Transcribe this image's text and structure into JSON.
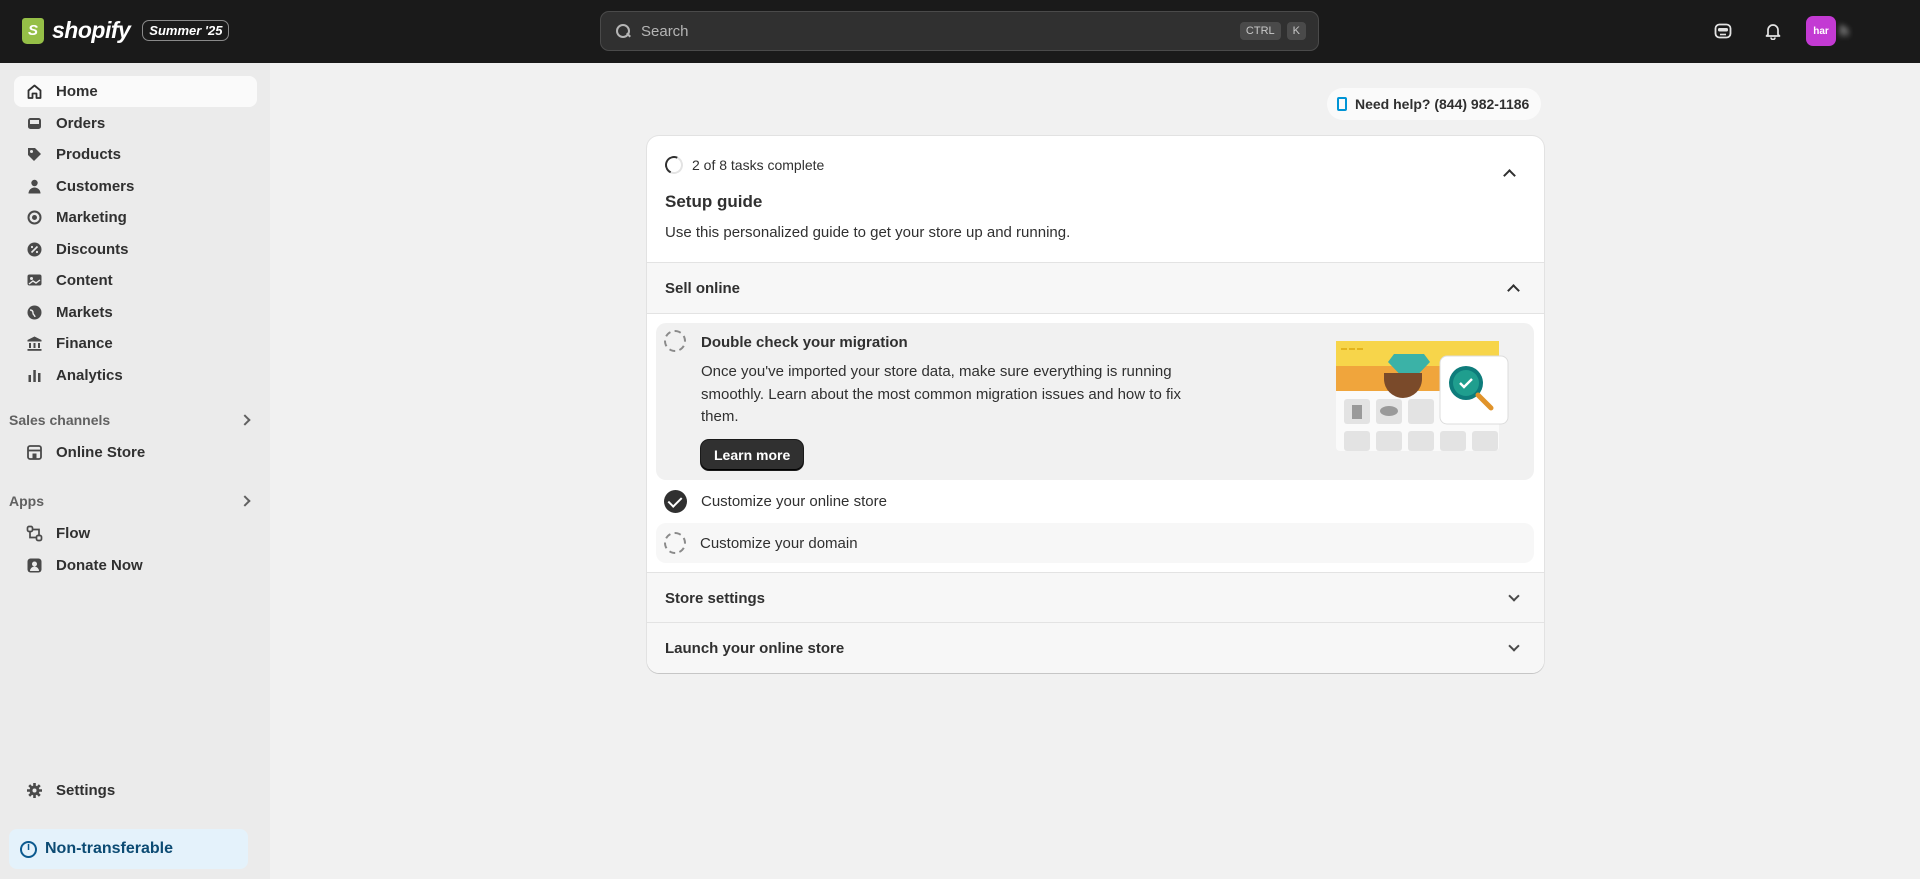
{
  "topbar": {
    "brand": "shopify",
    "edition": "Summer '25",
    "search_placeholder": "Search",
    "shortcut_ctrl": "CTRL",
    "shortcut_k": "K",
    "avatar_initials": "har",
    "account_name": "h"
  },
  "sidebar": {
    "items": [
      {
        "label": "Home",
        "icon": "home-icon"
      },
      {
        "label": "Orders",
        "icon": "inbox-icon"
      },
      {
        "label": "Products",
        "icon": "tag-icon"
      },
      {
        "label": "Customers",
        "icon": "person-icon"
      },
      {
        "label": "Marketing",
        "icon": "target-icon"
      },
      {
        "label": "Discounts",
        "icon": "discount-icon"
      },
      {
        "label": "Content",
        "icon": "image-icon"
      },
      {
        "label": "Markets",
        "icon": "globe-icon"
      },
      {
        "label": "Finance",
        "icon": "bank-icon"
      },
      {
        "label": "Analytics",
        "icon": "bar-chart-icon"
      }
    ],
    "sales_channels_label": "Sales channels",
    "sales_channels": [
      {
        "label": "Online Store",
        "icon": "store-icon"
      }
    ],
    "apps_label": "Apps",
    "apps": [
      {
        "label": "Flow",
        "icon": "flow-icon"
      },
      {
        "label": "Donate Now",
        "icon": "app-icon"
      }
    ],
    "settings_label": "Settings",
    "notice_label": "Non-transferable"
  },
  "help": {
    "label": "Need help? (844) 982-1186"
  },
  "setup_guide": {
    "progress": "2 of 8 tasks complete",
    "tasks_completed": 2,
    "tasks_total": 8,
    "title": "Setup guide",
    "subtitle": "Use this personalized guide to get your store up and running.",
    "sections": {
      "sell_online": "Sell online",
      "store_settings": "Store settings",
      "launch": "Launch your online store"
    },
    "active_task": {
      "title": "Double check your migration",
      "description": "Once you've imported your store data, make sure everything is running smoothly. Learn about the most common migration issues and how to fix them.",
      "button": "Learn more"
    },
    "tasks": [
      {
        "label": "Customize your online store",
        "done": true
      },
      {
        "label": "Customize your domain",
        "done": false
      }
    ]
  },
  "colors": {
    "topbar": "#1a1a1a",
    "sidebar": "#ebebeb",
    "accent_avatar": "#c33ad3",
    "notice_bg": "#e4f2fb"
  }
}
